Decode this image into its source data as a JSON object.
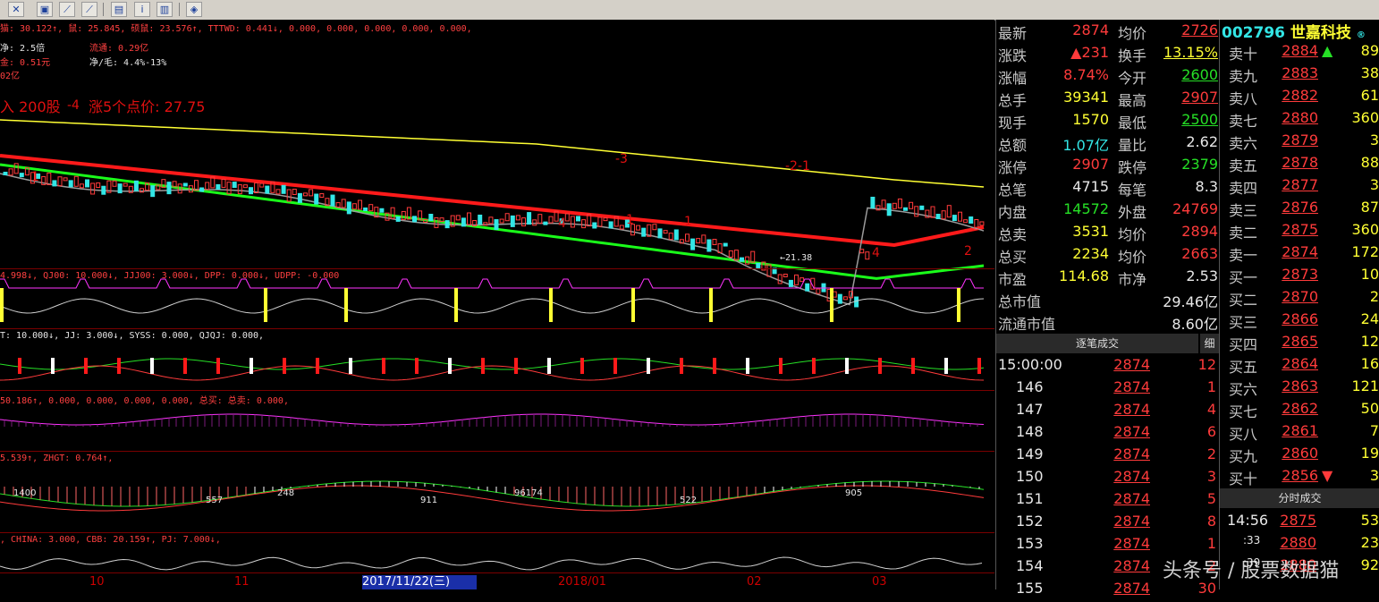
{
  "toolbar": {
    "icons": [
      "kline-icon",
      "picture-icon",
      "chart-line-icon",
      "chart-tools-icon",
      "document-icon",
      "info-icon",
      "stats-icon",
      "nav-icon"
    ]
  },
  "chart": {
    "main_indicator_line": "猫: 30.122↑, 鼠: 25.845, 硕鼠: 23.576↑, TTTWD: 0.441↓, 0.000, 0.000, 0.000, 0.000, 0.000,",
    "info_lines": [
      "净: 2.5倍",
      "金: 0.51元",
      "02亿"
    ],
    "float_text": "流通: 0.29亿",
    "ratio_text": "净/毛: 4.4%-13%",
    "buy_text": "入 200股",
    "rise_text": "涨5个点价: 27.75",
    "min_price_label": "←21.38",
    "wave_labels": [
      "-4",
      "1",
      "-3",
      "-2-1",
      "4",
      "1",
      "1",
      "4",
      "2"
    ],
    "ind1": "4.998↓, QJ00: 10.000↓, JJJ00: 3.000↓, DPP: 0.000↓, UDPP: -0.000",
    "ind2": "T: 10.000↓, JJ: 3.000↓, SYSS: 0.000, QJQJ: 0.000,",
    "ind3": "50.186↑, 0.000, 0.000, 0.000, 0.000, 总买: 总卖: 0.000,",
    "ind4": "5.539↑, ZHGT: 0.764↑,",
    "ind5": ", CHINA: 3.000, CBB: 20.159↑, PJ: 7.000↓,",
    "ind4_labels": [
      "1400",
      "557",
      "248",
      "911",
      "96174",
      "522",
      "905"
    ],
    "x_axis": [
      "10",
      "11",
      "2017/11/22(三)",
      "2018/01",
      "02",
      "03"
    ]
  },
  "quote": {
    "rows": [
      {
        "l1": "最新",
        "v1": "2874",
        "c1": "red",
        "l2": "均价",
        "v2": "2726",
        "c2": "red"
      },
      {
        "l1": "涨跌",
        "v1": "▲231",
        "c1": "red",
        "l2": "换手",
        "v2": "13.15%",
        "c2": "yel"
      },
      {
        "l1": "涨幅",
        "v1": "8.74%",
        "c1": "red",
        "l2": "今开",
        "v2": "2600",
        "c2": "grn"
      },
      {
        "l1": "总手",
        "v1": "39341",
        "c1": "yel",
        "l2": "最高",
        "v2": "2907",
        "c2": "red"
      },
      {
        "l1": "现手",
        "v1": "1570",
        "c1": "yel",
        "l2": "最低",
        "v2": "2500",
        "c2": "grn"
      },
      {
        "l1": "总额",
        "v1": "1.07亿",
        "c1": "cyan",
        "l2": "量比",
        "v2": "2.62",
        "c2": "wht"
      },
      {
        "l1": "涨停",
        "v1": "2907",
        "c1": "red",
        "l2": "跌停",
        "v2": "2379",
        "c2": "grn"
      },
      {
        "l1": "总笔",
        "v1": "4715",
        "c1": "wht",
        "l2": "每笔",
        "v2": "8.3",
        "c2": "wht"
      },
      {
        "l1": "内盘",
        "v1": "14572",
        "c1": "grn",
        "l2": "外盘",
        "v2": "24769",
        "c2": "red"
      },
      {
        "l1": "总卖",
        "v1": "3531",
        "c1": "yel",
        "l2": "均价",
        "v2": "2894",
        "c2": "red"
      },
      {
        "l1": "总买",
        "v1": "2234",
        "c1": "yel",
        "l2": "均价",
        "v2": "2663",
        "c2": "red"
      },
      {
        "l1": "市盈",
        "v1": "114.68",
        "c1": "yel",
        "l2": "市净",
        "v2": "2.53",
        "c2": "wht"
      }
    ],
    "mcap_label": "总市值",
    "mcap": "29.46亿",
    "fmcap_label": "流通市值",
    "fmcap": "8.60亿",
    "tick_tab": "逐笔成交",
    "detail_tab": "细",
    "ticks": [
      {
        "t": "15:00:00",
        "p": "2874",
        "v": "12"
      },
      {
        "t": "146",
        "p": "2874",
        "v": "1"
      },
      {
        "t": "147",
        "p": "2874",
        "v": "4"
      },
      {
        "t": "148",
        "p": "2874",
        "v": "6"
      },
      {
        "t": "149",
        "p": "2874",
        "v": "2"
      },
      {
        "t": "150",
        "p": "2874",
        "v": "3"
      },
      {
        "t": "151",
        "p": "2874",
        "v": "5"
      },
      {
        "t": "152",
        "p": "2874",
        "v": "8"
      },
      {
        "t": "153",
        "p": "2874",
        "v": "1"
      },
      {
        "t": "154",
        "p": "2874",
        "v": "2"
      },
      {
        "t": "155",
        "p": "2874",
        "v": "30"
      }
    ]
  },
  "orderbook": {
    "code": "002796",
    "name": "世嘉科技",
    "sells": [
      {
        "l": "卖十",
        "p": "2884",
        "v": "89"
      },
      {
        "l": "卖九",
        "p": "2883",
        "v": "38"
      },
      {
        "l": "卖八",
        "p": "2882",
        "v": "61"
      },
      {
        "l": "卖七",
        "p": "2880",
        "v": "360"
      },
      {
        "l": "卖六",
        "p": "2879",
        "v": "3"
      },
      {
        "l": "卖五",
        "p": "2878",
        "v": "88"
      },
      {
        "l": "卖四",
        "p": "2877",
        "v": "3"
      },
      {
        "l": "卖三",
        "p": "2876",
        "v": "87"
      },
      {
        "l": "卖二",
        "p": "2875",
        "v": "360"
      },
      {
        "l": "卖一",
        "p": "2874",
        "v": "172"
      }
    ],
    "buys": [
      {
        "l": "买一",
        "p": "2873",
        "v": "10"
      },
      {
        "l": "买二",
        "p": "2870",
        "v": "2"
      },
      {
        "l": "买三",
        "p": "2866",
        "v": "24"
      },
      {
        "l": "买四",
        "p": "2865",
        "v": "12"
      },
      {
        "l": "买五",
        "p": "2864",
        "v": "16"
      },
      {
        "l": "买六",
        "p": "2863",
        "v": "121"
      },
      {
        "l": "买七",
        "p": "2862",
        "v": "50"
      },
      {
        "l": "买八",
        "p": "2861",
        "v": "7"
      },
      {
        "l": "买九",
        "p": "2860",
        "v": "19"
      },
      {
        "l": "买十",
        "p": "2856",
        "v": "3"
      }
    ],
    "timeshare_tab": "分时成交",
    "timeshare": [
      {
        "t": "14:56",
        "p": "2875",
        "v": "53"
      },
      {
        "t": ":33",
        "p": "2880",
        "v": "23"
      },
      {
        "t": ":39",
        "p": "2880",
        "v": "92"
      }
    ]
  },
  "watermark": "头条号 / 股票数据猫",
  "colors": {
    "up": "#ff3b3b",
    "down": "#26e026",
    "ma_yellow": "#ffff33",
    "ma_red": "#ff1a1a",
    "ma_green": "#1aff1a",
    "grid": "#7a0000",
    "panel_bg": "#000000"
  }
}
